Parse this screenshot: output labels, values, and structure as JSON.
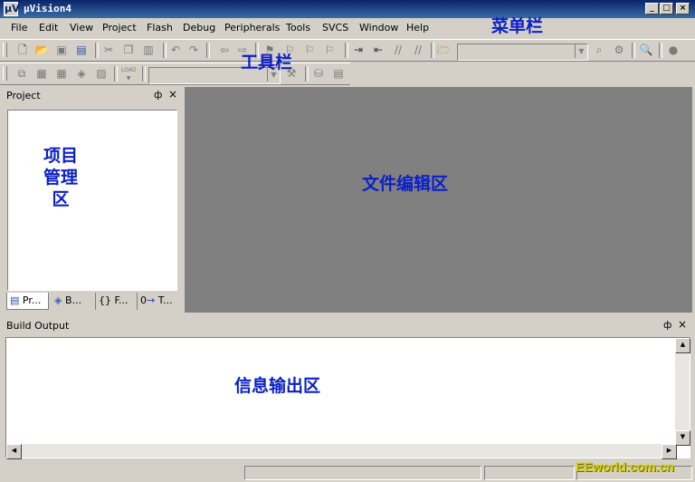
{
  "window": {
    "title": "μVision4",
    "icon_glyph": "μV"
  },
  "caption_buttons": {
    "minimize": "_",
    "maximize": "□",
    "close": "×"
  },
  "menu": [
    "File",
    "Edit",
    "View",
    "Project",
    "Flash",
    "Debug",
    "Peripherals",
    "Tools",
    "SVCS",
    "Window",
    "Help"
  ],
  "toolbar1": {
    "icons": [
      "new-file",
      "open-file",
      "save",
      "save-all",
      "cut",
      "copy",
      "paste",
      "undo",
      "redo",
      "navigate-back",
      "navigate-forward",
      "bookmark",
      "prev-bookmark",
      "next-bookmark",
      "clear-bookmarks",
      "indent",
      "unindent",
      "comment",
      "uncomment",
      "find-in-files",
      "find",
      "configure",
      "stop"
    ],
    "find_combo_value": ""
  },
  "toolbar2": {
    "icons": [
      "translate",
      "build",
      "rebuild",
      "batch-build",
      "stop-build",
      "download",
      "target-options",
      "manage-components",
      "books"
    ],
    "load_label": "LOAD",
    "target_combo_value": ""
  },
  "project_panel": {
    "title": "Project",
    "pin": "ф",
    "close": "×",
    "tabs": [
      {
        "label": "Pr...",
        "icon": "project-tab-icon"
      },
      {
        "label": "B...",
        "icon": "books-tab-icon"
      },
      {
        "label": "F...",
        "icon": "functions-tab-icon",
        "glyph": "{}"
      },
      {
        "label": "T...",
        "icon": "templates-tab-icon",
        "glyph": "0"
      }
    ]
  },
  "build_output": {
    "title": "Build Output",
    "pin": "ф",
    "close": "×"
  },
  "annotations": {
    "menubar": "菜单栏",
    "toolbar": "工具栏",
    "project_area_line1": "项目",
    "project_area_line2": "管理",
    "project_area_line3": "区",
    "editor_area": "文件编辑区",
    "output_area": "信息输出区"
  },
  "watermark": "EEworld.com.cn",
  "colors": {
    "titlebar": "#0a246a",
    "editor_bg": "#808080",
    "annotation": "#0a1fc8",
    "watermark": "#d8d000"
  }
}
